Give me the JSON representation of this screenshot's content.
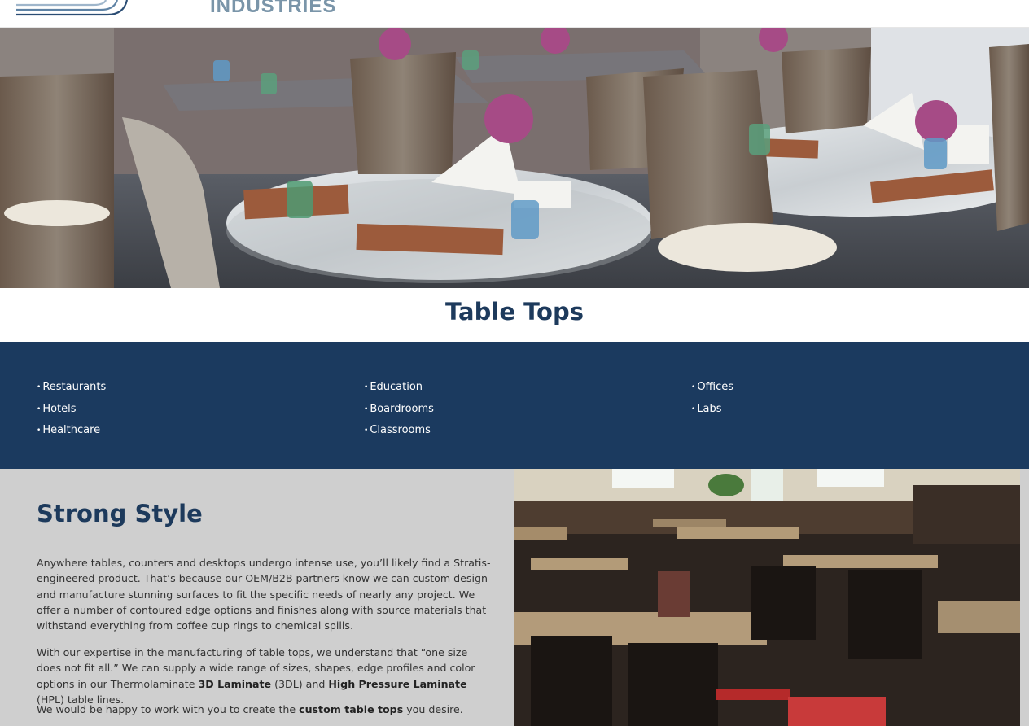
{
  "brand": {
    "name": "INDUSTRIES"
  },
  "page": {
    "title": "Table Tops"
  },
  "markets": {
    "col1": [
      "Restaurants",
      "Hotels",
      "Healthcare"
    ],
    "col2": [
      "Education",
      "Boardrooms",
      "Classrooms"
    ],
    "col3": [
      "Offices",
      "Labs"
    ]
  },
  "section": {
    "title": "Strong Style",
    "p1": "Anywhere tables, counters and desktops undergo intense use, you’ll likely find a Stratis-engineered product. That’s because our OEM/B2B partners know we can custom design and manufacture stunning surfaces to fit the specific needs of nearly any project. We offer a number of contoured edge options and finishes along with source materials that withstand everything from coffee cup rings to chemical spills.",
    "p2_a": "With our expertise in the manufacturing of table tops, we understand that “one size does not fit all.” We can supply a wide range of sizes, shapes, edge profiles and color options in our Thermolaminate ",
    "p2_b1": "3D Laminate",
    "p2_c": " (3DL) and ",
    "p2_b2": "High Pressure Laminate",
    "p2_d": " (HPL) table lines.",
    "p3_a": "We would be happy to work with you to create the ",
    "p3_b": "custom table tops",
    "p3_c": " you desire."
  }
}
